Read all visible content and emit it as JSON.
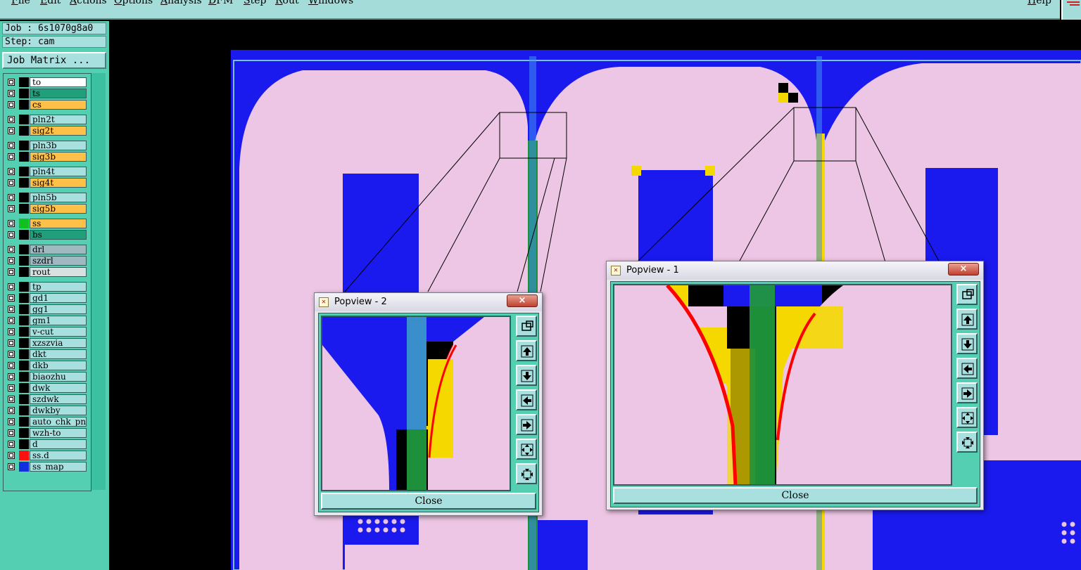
{
  "menu": {
    "items": [
      "File",
      "Edit",
      "Actions",
      "Options",
      "Analysis",
      "DFM",
      "Step",
      "Rout",
      "Windows"
    ],
    "help": "Help"
  },
  "job": {
    "job_label": "Job : 6s1070g8a0",
    "step_label": "Step: cam",
    "matrix_button": "Job Matrix ..."
  },
  "layers": [
    {
      "name": "to",
      "color": "#ffffff",
      "swatch": "#000000"
    },
    {
      "name": "ts",
      "color": "#1fa07a",
      "swatch": "#000000"
    },
    {
      "name": "cs",
      "color": "#ffc04a",
      "swatch": "#000000"
    },
    {
      "name": "pln2t",
      "color": "#a8e0e0",
      "swatch": "#000000"
    },
    {
      "name": "sig2t",
      "color": "#ffc04a",
      "swatch": "#000000"
    },
    {
      "name": "pln3b",
      "color": "#a8e0e0",
      "swatch": "#000000"
    },
    {
      "name": "sig3b",
      "color": "#ffc04a",
      "swatch": "#000000"
    },
    {
      "name": "pln4t",
      "color": "#a8e0e0",
      "swatch": "#000000"
    },
    {
      "name": "sig4t",
      "color": "#ffc04a",
      "swatch": "#000000"
    },
    {
      "name": "pln5b",
      "color": "#a8e0e0",
      "swatch": "#000000"
    },
    {
      "name": "sig5b",
      "color": "#ffc04a",
      "swatch": "#000000"
    },
    {
      "name": "ss",
      "color": "#ffc04a",
      "swatch": "#10c020"
    },
    {
      "name": "bs",
      "color": "#1fa07a",
      "swatch": "#000000"
    },
    {
      "name": "drl",
      "color": "#a0b8c0",
      "swatch": "#000000"
    },
    {
      "name": "szdrl",
      "color": "#a0b8c0",
      "swatch": "#000000"
    },
    {
      "name": "rout",
      "color": "#d8e0e0",
      "swatch": "#000000"
    },
    {
      "name": "tp",
      "color": "#a8e0e0",
      "swatch": "#000000"
    },
    {
      "name": "gd1",
      "color": "#a8e0e0",
      "swatch": "#000000"
    },
    {
      "name": "gg1",
      "color": "#a8e0e0",
      "swatch": "#000000"
    },
    {
      "name": "gm1",
      "color": "#a8e0e0",
      "swatch": "#000000"
    },
    {
      "name": "v-cut",
      "color": "#a8e0e0",
      "swatch": "#000000"
    },
    {
      "name": "xzszvia",
      "color": "#a8e0e0",
      "swatch": "#000000"
    },
    {
      "name": "dkt",
      "color": "#a8e0e0",
      "swatch": "#000000"
    },
    {
      "name": "dkb",
      "color": "#a8e0e0",
      "swatch": "#000000"
    },
    {
      "name": "biaozhu",
      "color": "#a8e0e0",
      "swatch": "#000000"
    },
    {
      "name": "dwk",
      "color": "#a8e0e0",
      "swatch": "#000000"
    },
    {
      "name": "szdwk",
      "color": "#a8e0e0",
      "swatch": "#000000"
    },
    {
      "name": "dwkby",
      "color": "#a8e0e0",
      "swatch": "#000000"
    },
    {
      "name": "auto_chk_pn",
      "color": "#a8e0e0",
      "swatch": "#000000"
    },
    {
      "name": "wzh-to",
      "color": "#a8e0e0",
      "swatch": "#000000"
    },
    {
      "name": "d",
      "color": "#a8e0e0",
      "swatch": "#000000"
    },
    {
      "name": "ss.d",
      "color": "#a8e0e0",
      "swatch": "#ff1010"
    },
    {
      "name": "ss_map",
      "color": "#a8e0e0",
      "swatch": "#1030e0"
    }
  ],
  "popview1": {
    "title": "Popview - 1",
    "close": "Close",
    "x_label": "×"
  },
  "popview2": {
    "title": "Popview - 2",
    "close": "Close",
    "x_label": "×"
  },
  "toolbar_icons": [
    "zoom-fit-icon",
    "pan-up-icon",
    "pan-down-icon",
    "pan-left-icon",
    "pan-right-icon",
    "zoom-out-icon",
    "zoom-in-icon"
  ],
  "colors": {
    "substrate": "#1a1aef",
    "copper": "#ecc6e4",
    "solder": "#f5d800",
    "trace": "#1e8f3a",
    "accent_red": "#ff0000",
    "panel": "#54cfb2"
  }
}
